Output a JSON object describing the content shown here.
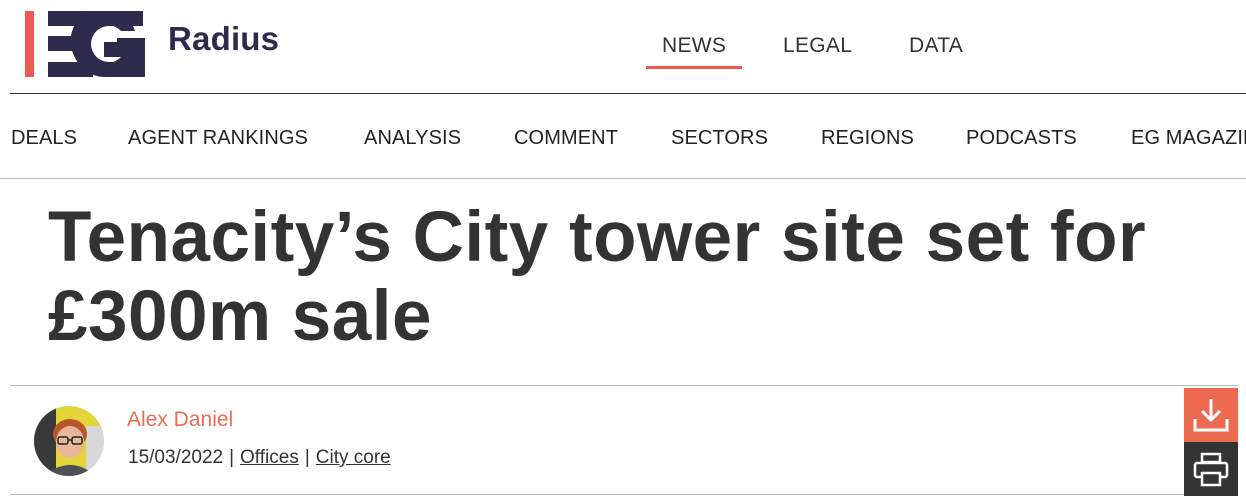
{
  "header": {
    "brand": "Radius",
    "logo_text": "EG",
    "colors": {
      "brand_navy": "#2e2c4d",
      "accent_red": "#ec5a54"
    },
    "top_nav": [
      {
        "label": "NEWS",
        "active": true
      },
      {
        "label": "LEGAL",
        "active": false
      },
      {
        "label": "DATA",
        "active": false
      }
    ]
  },
  "section_nav": [
    {
      "label": "DEALS"
    },
    {
      "label": "AGENT RANKINGS"
    },
    {
      "label": "ANALYSIS"
    },
    {
      "label": "COMMENT"
    },
    {
      "label": "SECTORS"
    },
    {
      "label": "REGIONS"
    },
    {
      "label": "PODCASTS"
    },
    {
      "label": "EG MAGAZINE"
    }
  ],
  "article": {
    "headline": "Tenacity’s City tower site set for £300m sale",
    "author": "Alex Daniel",
    "date": "15/03/2022",
    "separator": "|",
    "tags": [
      {
        "label": "Offices"
      },
      {
        "label": "City core"
      }
    ]
  },
  "tools": {
    "download_icon": "download-icon",
    "print_icon": "print-icon",
    "download_color": "#ec6a4f",
    "print_color": "#333333"
  }
}
